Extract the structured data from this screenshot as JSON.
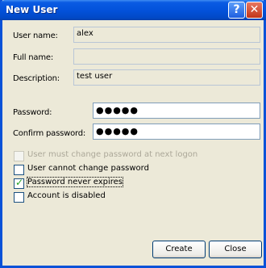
{
  "window": {
    "title": "New User",
    "help_glyph": "?",
    "close_glyph": "✕"
  },
  "fields": {
    "username": {
      "label": "User name:",
      "value": "alex"
    },
    "fullname": {
      "label": "Full name:",
      "value": ""
    },
    "description": {
      "label": "Description:",
      "value": "test user"
    },
    "password": {
      "label": "Password:",
      "value": "●●●●●"
    },
    "confirm": {
      "label": "Confirm password:",
      "value": "●●●●●"
    }
  },
  "checkboxes": [
    {
      "label": "User must change password at next logon",
      "checked": false,
      "disabled": true
    },
    {
      "label": "User cannot change password",
      "checked": false,
      "disabled": false
    },
    {
      "label": "Password never expires",
      "checked": true,
      "disabled": false
    },
    {
      "label": "Account is disabled",
      "checked": false,
      "disabled": false
    }
  ],
  "buttons": {
    "create": "Create",
    "close": "Close"
  }
}
